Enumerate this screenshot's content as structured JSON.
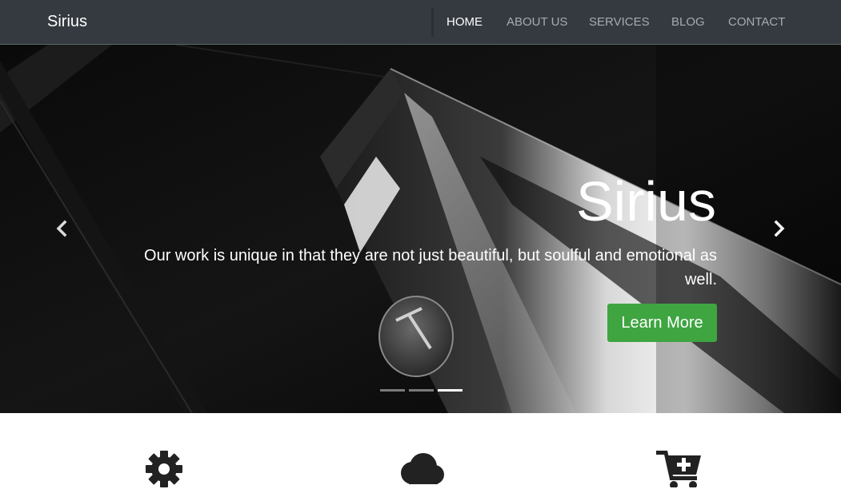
{
  "brand": "Sirius",
  "nav": {
    "items": [
      {
        "label": "HOME",
        "active": true
      },
      {
        "label": "ABOUT US",
        "active": false
      },
      {
        "label": "SERVICES",
        "active": false
      },
      {
        "label": "BLOG",
        "active": false
      },
      {
        "label": "CONTACT",
        "active": false
      }
    ]
  },
  "hero": {
    "title": "Sirius",
    "text": "Our work is unique in that they are not just beautiful, but soulful and emotional as well.",
    "button": "Learn More",
    "prev_icon": "chevron-left-icon",
    "next_icon": "chevron-right-icon",
    "active_slide": 3,
    "slide_count": 3
  },
  "features": {
    "icons": [
      "gear-icon",
      "cloud-icon",
      "cart-plus-icon"
    ]
  },
  "colors": {
    "navbar": "#343a40",
    "accent": "#3ea541",
    "nav_text": "#a6abb0",
    "nav_active": "#ffffff",
    "icon": "#222222"
  }
}
